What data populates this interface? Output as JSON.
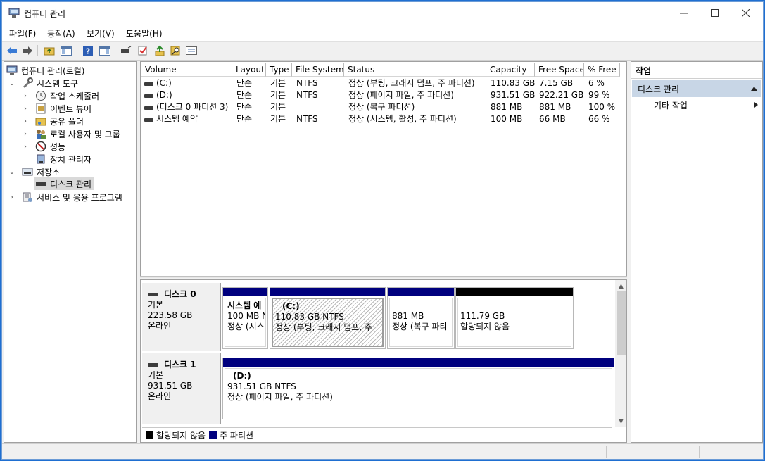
{
  "window": {
    "title": "컴퓨터 관리"
  },
  "menu": [
    {
      "label": "파일(F)",
      "name": "menu-file"
    },
    {
      "label": "동작(A)",
      "name": "menu-action"
    },
    {
      "label": "보기(V)",
      "name": "menu-view"
    },
    {
      "label": "도움말(H)",
      "name": "menu-help"
    }
  ],
  "tree": {
    "root": "컴퓨터 관리(로컬)",
    "system_tools": "시스템 도구",
    "task_scheduler": "작업 스케줄러",
    "event_viewer": "이벤트 뷰어",
    "shared_folders": "공유 폴더",
    "local_users": "로컬 사용자 및 그룹",
    "performance": "성능",
    "device_manager": "장치 관리자",
    "storage": "저장소",
    "disk_management": "디스크 관리",
    "services_apps": "서비스 및 응용 프로그램"
  },
  "volumes": {
    "columns": [
      "Volume",
      "Layout",
      "Type",
      "File System",
      "Status",
      "Capacity",
      "Free Space",
      "% Free"
    ],
    "rows": [
      [
        "(C:)",
        "단순",
        "기본",
        "NTFS",
        "정상 (부팅, 크래시 덤프, 주 파티션)",
        "110.83 GB",
        "7.15 GB",
        "6 %"
      ],
      [
        "(D:)",
        "단순",
        "기본",
        "NTFS",
        "정상 (페이지 파일, 주 파티션)",
        "931.51 GB",
        "922.21 GB",
        "99 %"
      ],
      [
        "(디스크 0 파티션 3)",
        "단순",
        "기본",
        "",
        "정상 (복구 파티션)",
        "881 MB",
        "881 MB",
        "100 %"
      ],
      [
        "시스템 예약",
        "단순",
        "기본",
        "NTFS",
        "정상 (시스템, 활성, 주 파티션)",
        "100 MB",
        "66 MB",
        "66 %"
      ]
    ]
  },
  "disks": [
    {
      "name": "디스크 0",
      "type": "기본",
      "size": "223.58 GB",
      "state": "온라인",
      "partitions": [
        {
          "title": "시스템 예",
          "line1": "100 MB N",
          "line2": "정상 (시스",
          "color": "#00007e"
        },
        {
          "title": "(C:)",
          "line1": "110.83 GB NTFS",
          "line2": "정상 (부팅, 크래시 덤프, 주",
          "color": "#00007e"
        },
        {
          "title": "",
          "line1": "881 MB",
          "line2": "정상 (복구 파티",
          "color": "#00007e"
        },
        {
          "title": "",
          "line1": "111.79 GB",
          "line2": "할당되지 않음",
          "color": "#000000"
        }
      ]
    },
    {
      "name": "디스크 1",
      "type": "기본",
      "size": "931.51 GB",
      "state": "온라인",
      "partitions": [
        {
          "title": "(D:)",
          "line1": "931.51 GB NTFS",
          "line2": "정상 (페이지 파일, 주 파티션)",
          "color": "#00007e"
        }
      ]
    }
  ],
  "legend": {
    "unallocated": "할당되지 않음",
    "primary": "주 파티션",
    "unallocated_color": "#000000",
    "primary_color": "#00007e"
  },
  "actions": {
    "header": "작업",
    "section": "디스크 관리",
    "more": "기타 작업"
  }
}
